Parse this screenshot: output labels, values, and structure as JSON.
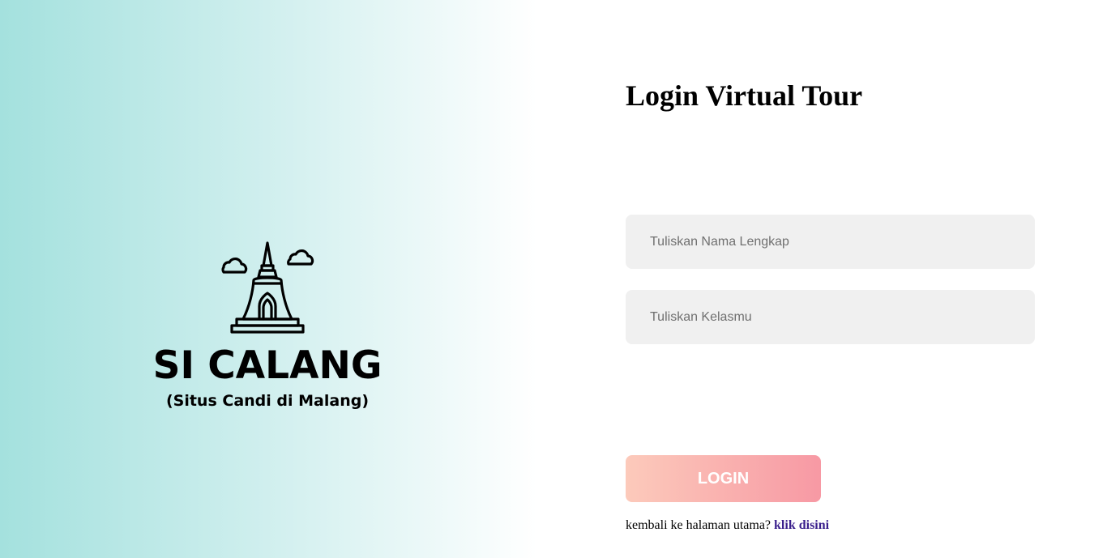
{
  "brand": {
    "title": "SI CALANG",
    "subtitle": "(Situs Candi di Malang)",
    "icon": "temple-stupa-icon"
  },
  "login": {
    "title": "Login Virtual Tour",
    "name_placeholder": "Tuliskan Nama Lengkap",
    "name_value": "",
    "class_placeholder": "Tuliskan Kelasmu",
    "class_value": "",
    "button_label": "LOGIN",
    "back_text": "kembali ke halaman utama?",
    "back_link_label": "klik disini"
  },
  "colors": {
    "gradient_left": "#a4e1de",
    "button_start": "#fccabb",
    "button_end": "#f799a4",
    "field_bg": "#f0f0f0",
    "link": "#3a1f8c"
  }
}
